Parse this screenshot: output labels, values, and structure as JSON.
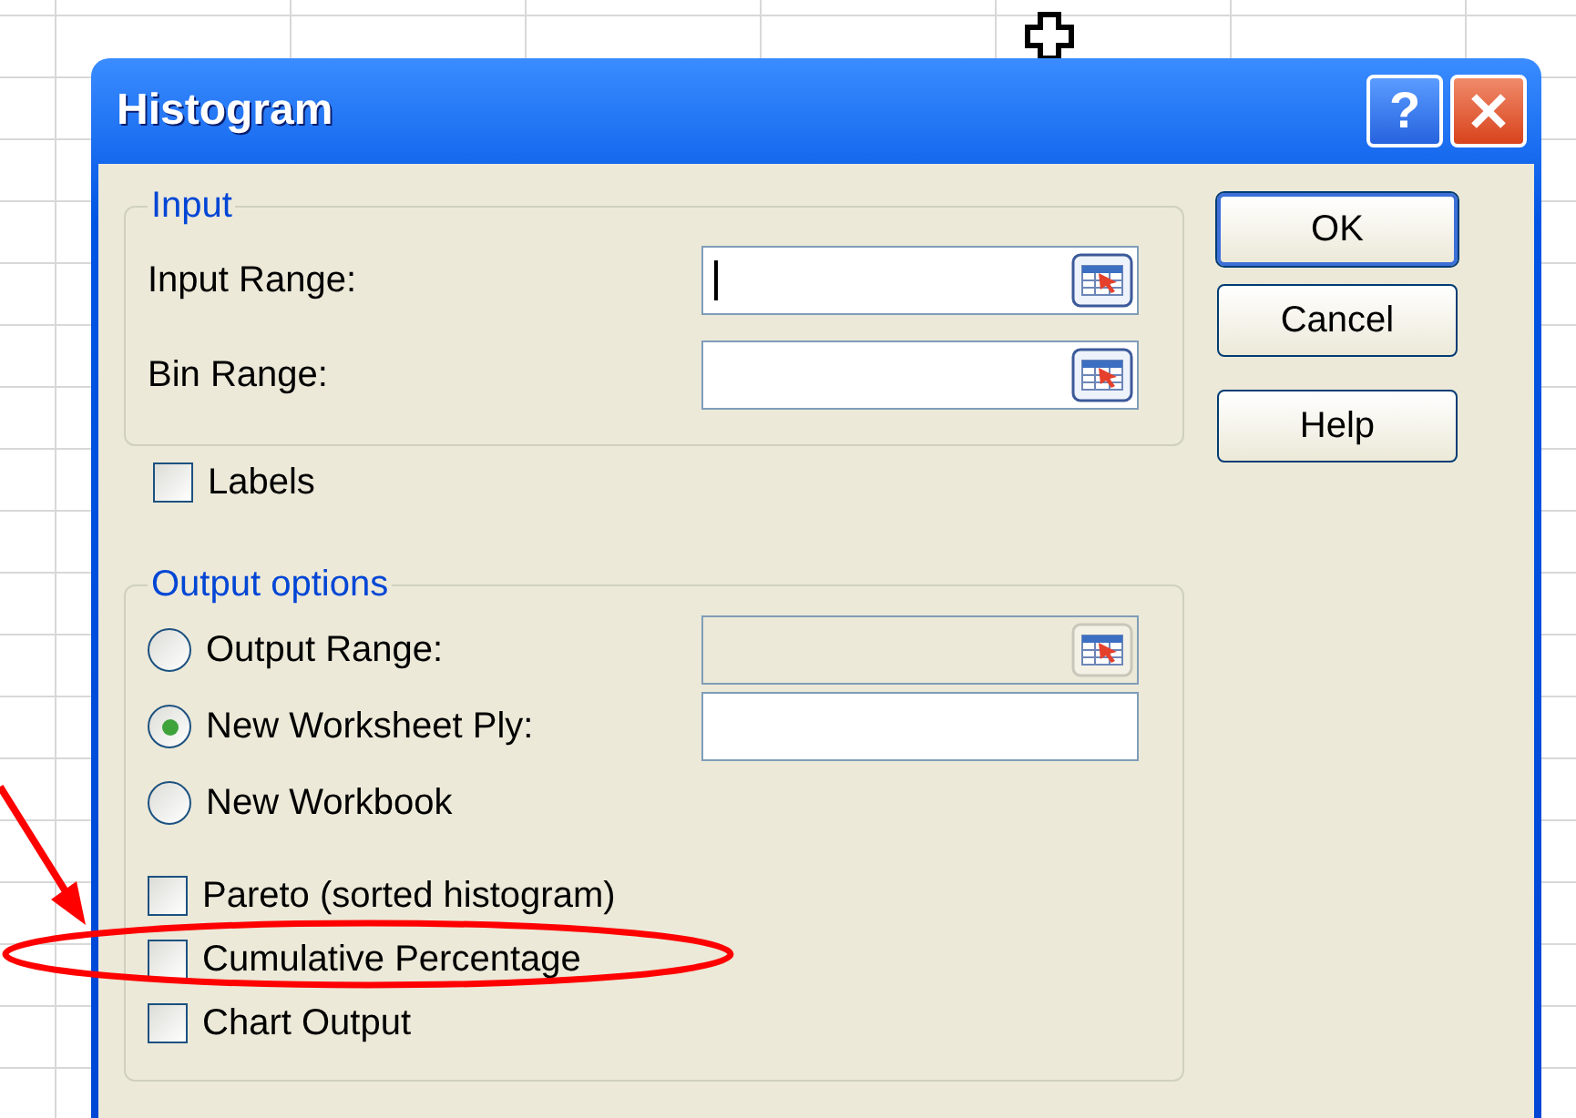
{
  "window": {
    "title": "Histogram",
    "help_glyph": "?"
  },
  "input_group": {
    "title": "Input",
    "fields": [
      {
        "label": "Input Range:",
        "focused": true
      },
      {
        "label": "Bin Range:",
        "focused": false
      }
    ]
  },
  "labels_checkbox": {
    "label": "Labels",
    "checked": false
  },
  "output_group": {
    "title": "Output options",
    "options": [
      {
        "label": "Output Range:",
        "selected": false,
        "field": {
          "disabled": true,
          "picker": true
        }
      },
      {
        "label": "New Worksheet Ply:",
        "selected": true,
        "field": {
          "disabled": false,
          "picker": false
        }
      },
      {
        "label": "New Workbook",
        "selected": false
      }
    ],
    "checkboxes": [
      {
        "label": "Pareto (sorted histogram)",
        "checked": false
      },
      {
        "label": "Cumulative Percentage",
        "checked": false
      },
      {
        "label": "Chart Output",
        "checked": false
      }
    ]
  },
  "buttons": [
    {
      "label": "OK",
      "default": true
    },
    {
      "label": "Cancel",
      "default": false
    },
    {
      "label": "Help",
      "default": false
    }
  ]
}
